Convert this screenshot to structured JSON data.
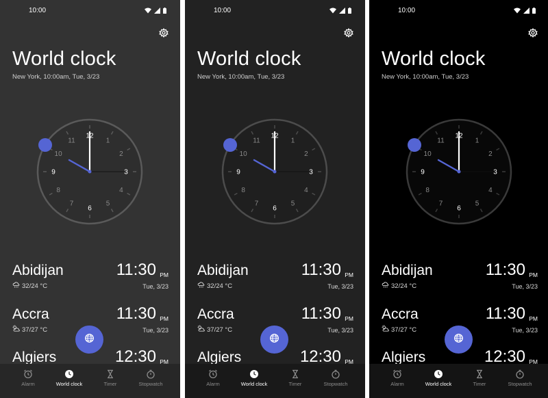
{
  "status_time": "10:00",
  "title": "World clock",
  "subtitle": "New York, 10:00am, Tue, 3/23",
  "clock_numbers": [
    "12",
    "1",
    "2",
    "3",
    "4",
    "5",
    "6",
    "7",
    "8",
    "9",
    "10",
    "11"
  ],
  "cities": [
    {
      "name": "Abidijan",
      "weather": "32/24 °C",
      "time": "11:30",
      "ampm": "PM",
      "date": "Tue, 3/23"
    },
    {
      "name": "Accra",
      "weather": "37/27 °C",
      "time": "11:30",
      "ampm": "PM",
      "date": "Tue, 3/23"
    },
    {
      "name": "Algiers",
      "weather": "",
      "time": "12:30",
      "ampm": "PM",
      "date": ""
    }
  ],
  "nav": [
    {
      "label": "Alarm",
      "icon": "alarm-icon"
    },
    {
      "label": "World clock",
      "icon": "world-clock-icon"
    },
    {
      "label": "Timer",
      "icon": "hourglass-icon"
    },
    {
      "label": "Stopwatch",
      "icon": "stopwatch-icon"
    }
  ],
  "fab_icon": "globe-icon",
  "colors": {
    "accent": "#5565d4"
  },
  "variants": [
    {
      "background": "#333333",
      "navbar": "#272727",
      "clock_ring": "#5a5a5a",
      "clock_face": "#2e2e2e",
      "nav_active": "world-clock"
    },
    {
      "background": "#222222",
      "navbar": "#191919",
      "clock_ring": "#4c4c4c",
      "clock_face": "#1f1f1f",
      "nav_active": "world-clock"
    },
    {
      "background": "#000000",
      "navbar": "#141414",
      "clock_ring": "#3a3a3a",
      "clock_face": "#080808",
      "nav_active": "world-clock"
    }
  ]
}
